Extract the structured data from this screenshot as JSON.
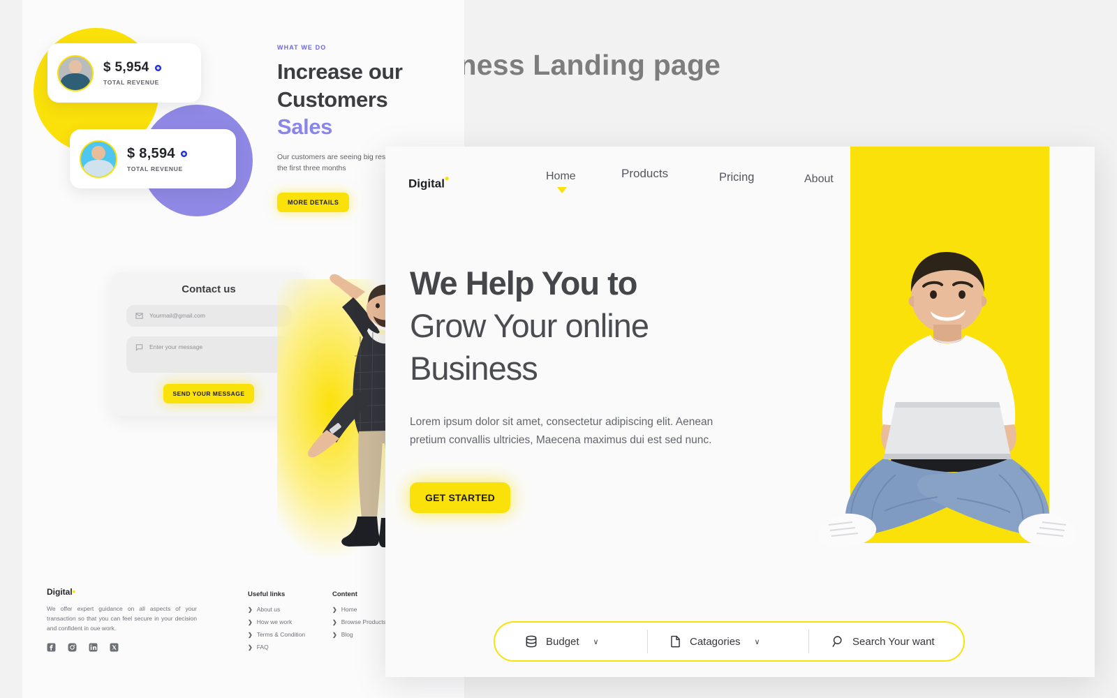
{
  "page": {
    "title": "Business Landing page"
  },
  "mockup": {
    "revenue_cards": [
      {
        "amount": "$ 5,954",
        "label": "TOTAL REVENUE",
        "avatar": "avatar-analyst"
      },
      {
        "amount": "$ 8,594",
        "label": "TOTAL REVENUE",
        "avatar": "avatar-consultant"
      }
    ],
    "what_we_do": {
      "eyebrow": "WHAT WE DO",
      "heading_line1": "Increase our",
      "heading_line2": "Customers",
      "heading_accent": "Sales",
      "paragraph": "Our customers are seeing big results within the first three months",
      "button": "MORE DETAILS"
    },
    "contact": {
      "title": "Contact us",
      "email_placeholder": "Yourmail@gmail.com",
      "message_placeholder": "Enter your message",
      "submit": "SEND YOUR MESSAGE"
    },
    "footer": {
      "logo": "Digital",
      "logo_dot": "•",
      "description": "We offer expert guidance on all aspects of your transaction so that you can feel secure in your decision and confident in oue work.",
      "socials": [
        {
          "name": "facebook-icon",
          "glyph": "f"
        },
        {
          "name": "instagram-icon",
          "glyph": "◎"
        },
        {
          "name": "linkedin-icon",
          "glyph": "in"
        },
        {
          "name": "x-twitter-icon",
          "glyph": "✕"
        }
      ],
      "columns": [
        {
          "heading": "Useful links",
          "links": [
            "About us",
            "How we work",
            "Terms & Condition",
            "FAQ"
          ]
        },
        {
          "heading": "Content",
          "links": [
            "Home",
            "Browse Products",
            "Blog"
          ]
        }
      ]
    }
  },
  "landing": {
    "brand": {
      "name": "Digital",
      "dot": "•"
    },
    "nav": [
      {
        "label": "Home",
        "active": true
      },
      {
        "label": "Products",
        "active": false
      },
      {
        "label": "Pricing",
        "active": false
      },
      {
        "label": "About",
        "active": false
      }
    ],
    "hero": {
      "line1": "We Help You to",
      "line2": "Grow Your online",
      "line3": "Business",
      "paragraph": "Lorem ipsum dolor sit amet, consectetur adipiscing elit. Aenean pretium convallis ultricies, Maecena maximus dui est sed nunc.",
      "cta": "GET STARTED"
    },
    "searchbar": {
      "budget_label": "Budget",
      "budget_icon": "database-icon",
      "categories_label": "Catagories",
      "categories_icon": "document-icon",
      "search_placeholder": "Search Your want",
      "search_icon": "search-icon",
      "chevron": "∨"
    }
  },
  "colors": {
    "accent_yellow": "#fbe10a",
    "accent_purple": "#8a85e8",
    "brand_dark": "#1d1e22",
    "dot_blue": "#1d2fe0"
  }
}
